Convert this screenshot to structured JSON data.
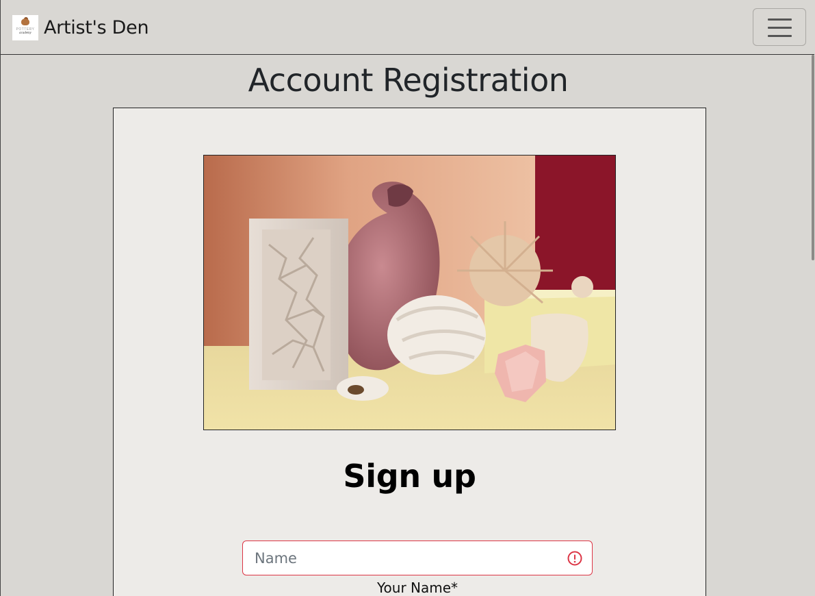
{
  "navbar": {
    "brand_name": "Artist's Den",
    "logo_text_top": "POTTERY",
    "logo_text_bottom": "academy",
    "toggler_icon": "hamburger-menu-icon"
  },
  "page": {
    "title": "Account Registration"
  },
  "form": {
    "heading": "Sign up",
    "name_field": {
      "placeholder": "Name",
      "value": "",
      "label": "Your Name*",
      "status_icon": "error-circle-icon"
    }
  },
  "colors": {
    "background": "#d9d7d3",
    "card": "#edebe8",
    "invalid": "#dc3545"
  }
}
